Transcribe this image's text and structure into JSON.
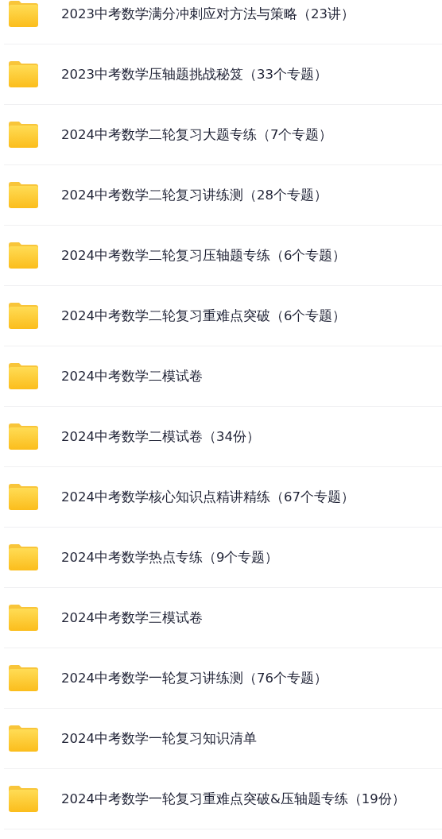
{
  "folders": [
    {
      "name": "2023中考数学满分冲刺应对方法与策略（23讲）"
    },
    {
      "name": "2023中考数学压轴题挑战秘笈（33个专题）"
    },
    {
      "name": "2024中考数学二轮复习大题专练（7个专题）"
    },
    {
      "name": "2024中考数学二轮复习讲练测（28个专题）"
    },
    {
      "name": "2024中考数学二轮复习压轴题专练（6个专题）"
    },
    {
      "name": "2024中考数学二轮复习重难点突破（6个专题）"
    },
    {
      "name": "2024中考数学二模试卷"
    },
    {
      "name": "2024中考数学二模试卷（34份）"
    },
    {
      "name": "2024中考数学核心知识点精讲精练（67个专题）"
    },
    {
      "name": "2024中考数学热点专练（9个专题）"
    },
    {
      "name": "2024中考数学三模试卷"
    },
    {
      "name": "2024中考数学一轮复习讲练测（76个专题）"
    },
    {
      "name": "2024中考数学一轮复习知识清单"
    },
    {
      "name": "2024中考数学一轮复习重难点突破&压轴题专练（19份）"
    }
  ]
}
